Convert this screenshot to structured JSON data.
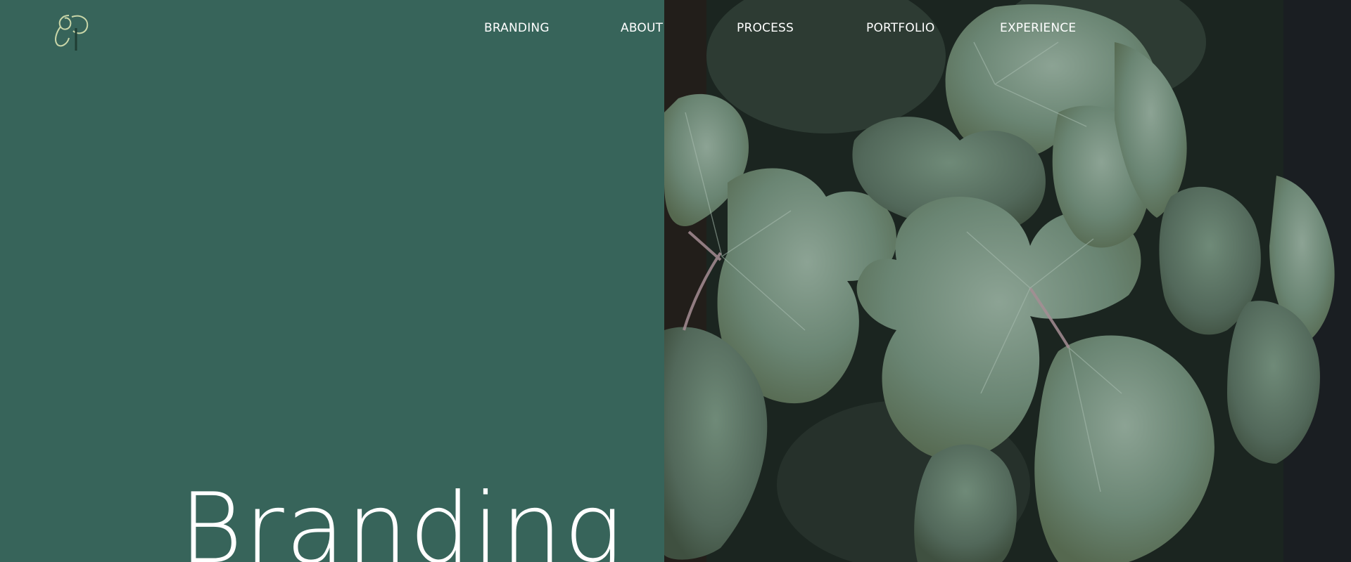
{
  "nav": {
    "items": [
      {
        "label": "BRANDING"
      },
      {
        "label": "ABOUT"
      },
      {
        "label": "PROCESS"
      },
      {
        "label": "PORTFOLIO"
      },
      {
        "label": "EXPERIENCE"
      }
    ]
  },
  "hero": {
    "title": "Branding"
  },
  "colors": {
    "panel_green": "#37645a",
    "leaf_green": "#6f8a78",
    "text": "#ffffff"
  },
  "logo": {
    "icon": "monogram-logo-icon"
  },
  "image": {
    "icon": "leaves-photo"
  }
}
